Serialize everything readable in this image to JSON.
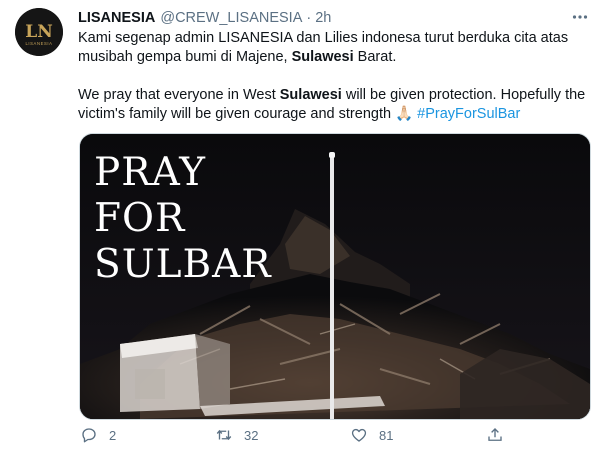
{
  "tweet": {
    "display_name": "LISANESIA",
    "handle": "@CREW_LISANESIA",
    "separator": "·",
    "time": "2h",
    "avatar_text": "LN",
    "avatar_subtext": "LISANESIA",
    "text_line1_pre": "Kami segenap admin LISANESIA dan Lilies indonesa turut berduka cita atas musibah gempa bumi di Majene, ",
    "text_line1_bold": "Sulawesi",
    "text_line1_post": " Barat.",
    "text_line2_pre": "We pray that everyone in West ",
    "text_line2_bold": "Sulawesi",
    "text_line2_post": " will be given protection. Hopefully the victim's family will be given courage and strength ",
    "emoji": "🙏🏻",
    "hashtag": "#PrayForSulBar"
  },
  "media": {
    "overlay_line1": "PRAY",
    "overlay_line2": "FOR",
    "overlay_line3": "SULBAR"
  },
  "actions": {
    "reply_count": "2",
    "retweet_count": "32",
    "like_count": "81"
  },
  "icons": {
    "more": "more-horizontal-icon",
    "reply": "reply-icon",
    "retweet": "retweet-icon",
    "like": "heart-icon",
    "share": "share-icon"
  },
  "colors": {
    "secondary_text": "#5b7083",
    "link": "#1b95e0",
    "avatar_bg": "#151515",
    "avatar_gold": "#c9a55a"
  }
}
